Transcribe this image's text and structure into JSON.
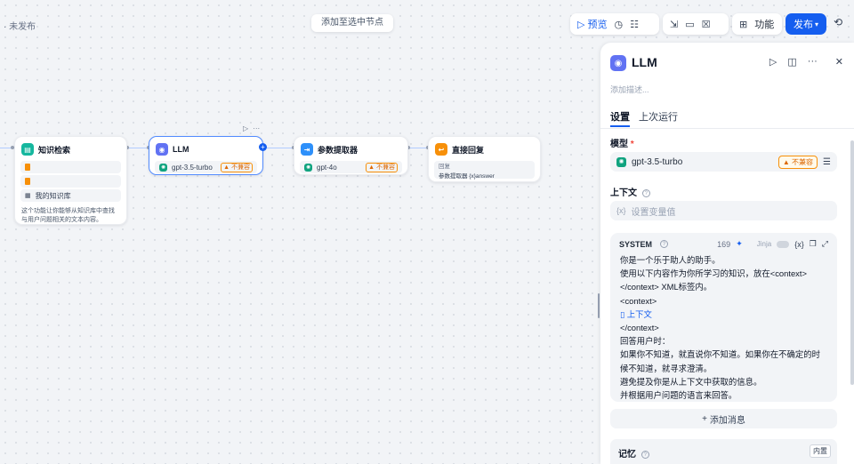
{
  "topbar": {
    "status": "· 未发布",
    "toast": "添加至选中节点",
    "preview_label": "预览",
    "features_label": "功能",
    "publish_label": "发布",
    "icons": {
      "preview": "play-icon",
      "checklist": "checklist-icon",
      "env": "env-icon",
      "history": "history-icon"
    }
  },
  "canvas": {
    "nodes": [
      {
        "id": "knowledge",
        "title": "知识检索",
        "icon": "book-icon",
        "icon_color": "#15b79e",
        "rows": [
          "",
          "",
          "我的知识库"
        ],
        "desc": "这个功能让你能够从知识库中查找与用户问题相关的文本内容。"
      },
      {
        "id": "llm",
        "title": "LLM",
        "icon": "brain-icon",
        "icon_color": "#6172f3",
        "model": "gpt-3.5-turbo",
        "warn": "不兼容"
      },
      {
        "id": "extractor",
        "title": "参数提取器",
        "icon": "extract-icon",
        "icon_color": "#2e90fa",
        "model": "gpt-4o",
        "warn": "不兼容"
      },
      {
        "id": "answer",
        "title": "直接回复",
        "icon": "reply-icon",
        "icon_color": "#f79009",
        "answer_label": "回复",
        "answer_value": "参数提取器 {x}answer"
      }
    ]
  },
  "panel": {
    "title": "LLM",
    "desc_placeholder": "添加描述...",
    "tabs": [
      "设置",
      "上次运行"
    ],
    "model_label": "模型",
    "model_required": "*",
    "model_name": "gpt-3.5-turbo",
    "model_warn": "不兼容",
    "context_label": "上下文",
    "context_placeholder": "设置变量值",
    "system": {
      "label": "SYSTEM",
      "tokens": "169",
      "jinja": "Jinja",
      "var": "{x}",
      "lines_before": "你是一个乐于助人的助手。\n使用以下内容作为你所学习的知识，放在<context>\n</context> XML标签内。\n<context>",
      "context_var": "上下文",
      "lines_after": "</context>\n回答用户时：\n如果你不知道，就直说你不知道。如果你在不确定的时候不知道，就寻求澄清。\n避免提及你是从上下文中获取的信息。\n并根据用户问题的语言来回答。"
    },
    "add_message": "添加消息",
    "memory_label": "记忆",
    "memory_badge": "内置"
  }
}
